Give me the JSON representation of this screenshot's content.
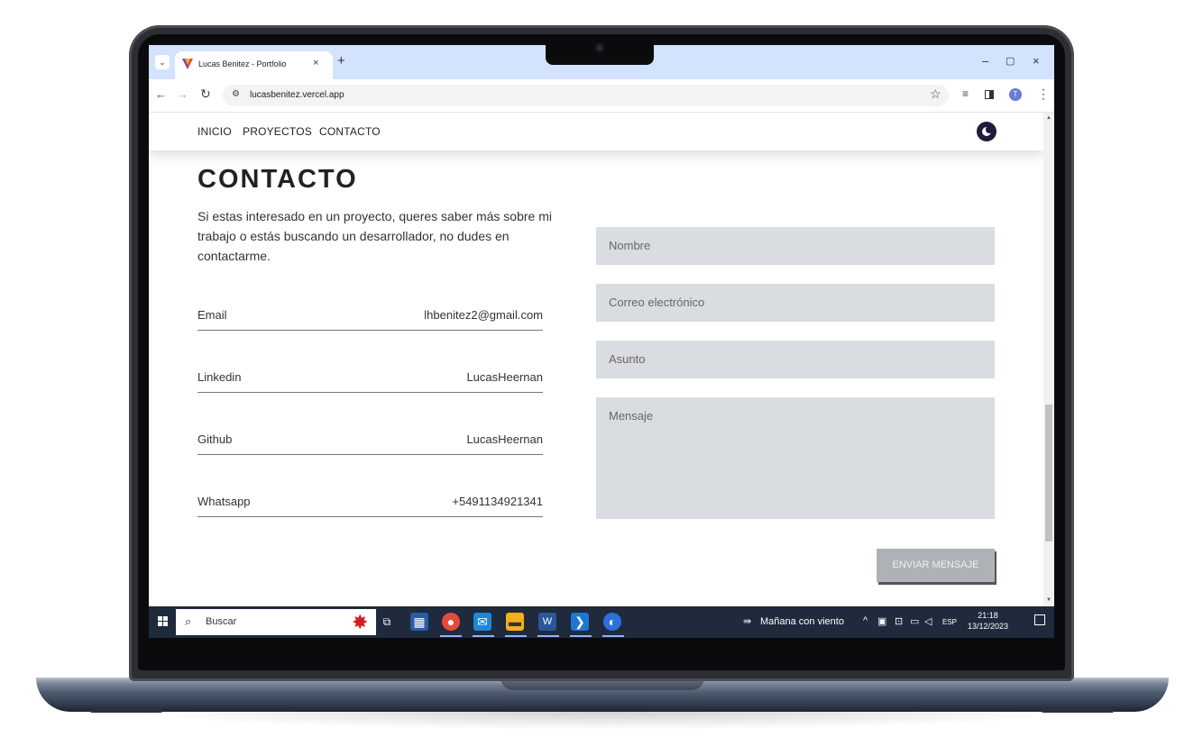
{
  "browser": {
    "tab_title": "Lucas Benitez - Portfolio",
    "tab_close": "×",
    "new_tab": "+",
    "url": "lucasbenitez.vercel.app",
    "window_controls": {
      "minimize": "–",
      "maximize": "▢",
      "close": "×"
    },
    "profile_initial": "T",
    "icons": [
      "back-arrow",
      "forward-arrow",
      "reload",
      "site-settings",
      "star-bookmark",
      "media-control",
      "side-panel",
      "profile",
      "menu"
    ]
  },
  "site": {
    "nav": [
      {
        "label": "INICIO"
      },
      {
        "label": "PROYECTOS"
      },
      {
        "label": "CONTACTO"
      }
    ],
    "heading": "CONTACTO",
    "intro": "Si estas interesado en un proyecto, queres saber más sobre mi trabajo o estás buscando un desarrollador, no dudes en contactarme.",
    "contacts": [
      {
        "label": "Email",
        "value": "lhbenitez2@gmail.com"
      },
      {
        "label": "Linkedin",
        "value": "LucasHeernan"
      },
      {
        "label": "Github",
        "value": "LucasHeernan"
      },
      {
        "label": "Whatsapp",
        "value": "+5491134921341"
      }
    ],
    "form": {
      "name_placeholder": "Nombre",
      "email_placeholder": "Correo electrónico",
      "subject_placeholder": "Asunto",
      "message_placeholder": "Mensaje",
      "submit_label": "ENVIAR MENSAJE"
    }
  },
  "taskbar": {
    "search_placeholder": "Buscar",
    "weather": "Mañana con viento",
    "language": "ESP",
    "time": "21:18",
    "date": "13/12/2023"
  }
}
